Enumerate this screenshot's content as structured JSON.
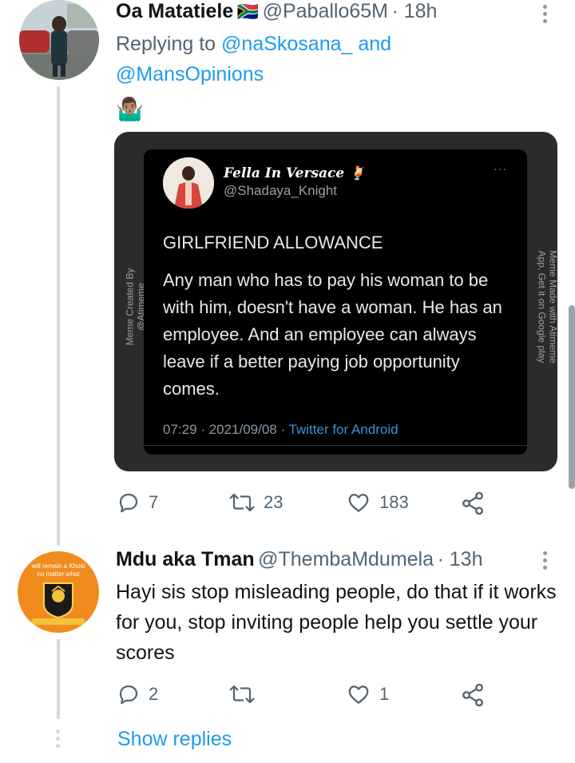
{
  "tweet1": {
    "name": "Oa Matatiele",
    "flag": "🇿🇦",
    "handle": "@Paballo65M",
    "time": "· 18h",
    "replying_prefix": "Replying to ",
    "replying_user1": "@naSkosana_",
    "replying_and": " and",
    "replying_user2": "@MansOpinions",
    "emoji": "🤷🏽‍♂️",
    "embed": {
      "name": "Fella In Versace",
      "name_emoji": "🍹",
      "handle": "@Shadaya_Knight",
      "more": "···",
      "heading": "GIRLFRIEND ALLOWANCE",
      "body": "Any man who has to pay his woman to be with him, doesn't have a woman. He has an employee. And an employee can always leave if a better paying job opportunity comes.",
      "timestamp": "07:29 · 2021/09/08 · ",
      "source": "Twitter for Android",
      "side_left_1": "Meme Created By",
      "side_left_2": "@Atimeme",
      "side_right_1": "Meme Made with Atimeme",
      "side_right_2": "App, Get it on Google play"
    },
    "actions": {
      "replies": "7",
      "retweets": "23",
      "likes": "183"
    }
  },
  "tweet2": {
    "name": "Mdu aka Tman",
    "handle": "@ThembaMdumela",
    "time": "· 13h",
    "text": "Hayi sis stop misleading people, do that if it works for you, stop inviting people help you settle your scores",
    "avatar_text_1": "will remain a Khosi",
    "avatar_text_2": "no matter what",
    "avatar_badge": "KAIZER CHIEFS",
    "actions": {
      "replies": "2",
      "retweets": "",
      "likes": "1"
    }
  },
  "show_replies": "Show replies",
  "colors": {
    "link": "#1d9bf0",
    "secondary": "#536471",
    "thread": "#cfd9de"
  }
}
